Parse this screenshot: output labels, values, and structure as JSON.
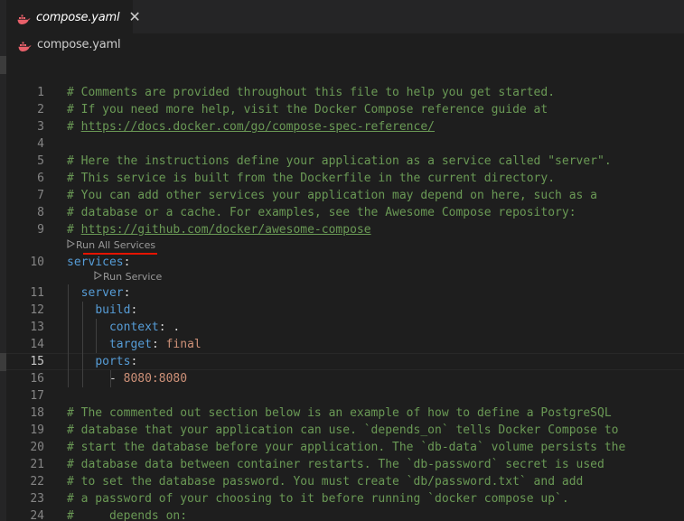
{
  "tab": {
    "label": "compose.yaml",
    "close_glyph": "✕",
    "icon": "docker-whale-icon"
  },
  "breadcrumb": {
    "label": "compose.yaml",
    "icon": "docker-whale-icon"
  },
  "codelens": {
    "run_all": "Run All Services",
    "run_service": "Run Service"
  },
  "editor": {
    "current_line": "15",
    "lines": [
      {
        "n": "1",
        "t": "comment",
        "text": "# Comments are provided throughout this file to help you get started."
      },
      {
        "n": "2",
        "t": "comment",
        "text": "# If you need more help, visit the Docker Compose reference guide at"
      },
      {
        "n": "3",
        "t": "link",
        "prefix": "# ",
        "text": "https://docs.docker.com/go/compose-spec-reference/"
      },
      {
        "n": "4",
        "t": "empty",
        "text": ""
      },
      {
        "n": "5",
        "t": "comment",
        "text": "# Here the instructions define your application as a service called \"server\"."
      },
      {
        "n": "6",
        "t": "comment",
        "text": "# This service is built from the Dockerfile in the current directory."
      },
      {
        "n": "7",
        "t": "comment",
        "text": "# You can add other services your application may depend on here, such as a"
      },
      {
        "n": "8",
        "t": "comment",
        "text": "# database or a cache. For examples, see the Awesome Compose repository:"
      },
      {
        "n": "9",
        "t": "link",
        "prefix": "# ",
        "text": "https://github.com/docker/awesome-compose"
      },
      {
        "n": "10",
        "t": "yaml",
        "indent": "",
        "key": "services",
        "sep": ":",
        "value": ""
      },
      {
        "n": "11",
        "t": "yaml",
        "indent": "  ",
        "key": "server",
        "sep": ":",
        "value": ""
      },
      {
        "n": "12",
        "t": "yaml",
        "indent": "    ",
        "key": "build",
        "sep": ":",
        "value": ""
      },
      {
        "n": "13",
        "t": "yaml",
        "indent": "      ",
        "key": "context",
        "sep": ": ",
        "value": "."
      },
      {
        "n": "14",
        "t": "yaml",
        "indent": "      ",
        "key": "target",
        "sep": ": ",
        "value": "final"
      },
      {
        "n": "15",
        "t": "yaml",
        "indent": "    ",
        "key": "ports",
        "sep": ":",
        "value": ""
      },
      {
        "n": "16",
        "t": "list",
        "indent": "      ",
        "dash": "- ",
        "value": "8080:8080"
      },
      {
        "n": "17",
        "t": "empty",
        "text": ""
      },
      {
        "n": "18",
        "t": "comment",
        "text": "# The commented out section below is an example of how to define a PostgreSQL"
      },
      {
        "n": "19",
        "t": "comment",
        "text": "# database that your application can use. `depends_on` tells Docker Compose to"
      },
      {
        "n": "20",
        "t": "comment",
        "text": "# start the database before your application. The `db-data` volume persists the"
      },
      {
        "n": "21",
        "t": "comment",
        "text": "# database data between container restarts. The `db-password` secret is used"
      },
      {
        "n": "22",
        "t": "comment",
        "text": "# to set the database password. You must create `db/password.txt` and add"
      },
      {
        "n": "23",
        "t": "comment",
        "text": "# a password of your choosing to it before running `docker compose up`."
      },
      {
        "n": "24",
        "t": "comment",
        "text": "#     depends_on:"
      }
    ]
  },
  "colors": {
    "background": "#1e1e1e",
    "comment": "#6a9955",
    "key": "#569cd6",
    "string": "#ce9178",
    "line_number": "#858585",
    "active_line_number": "#c6c6c6",
    "docker_red": "#e8606a",
    "annotation_underline": "#e51400"
  }
}
